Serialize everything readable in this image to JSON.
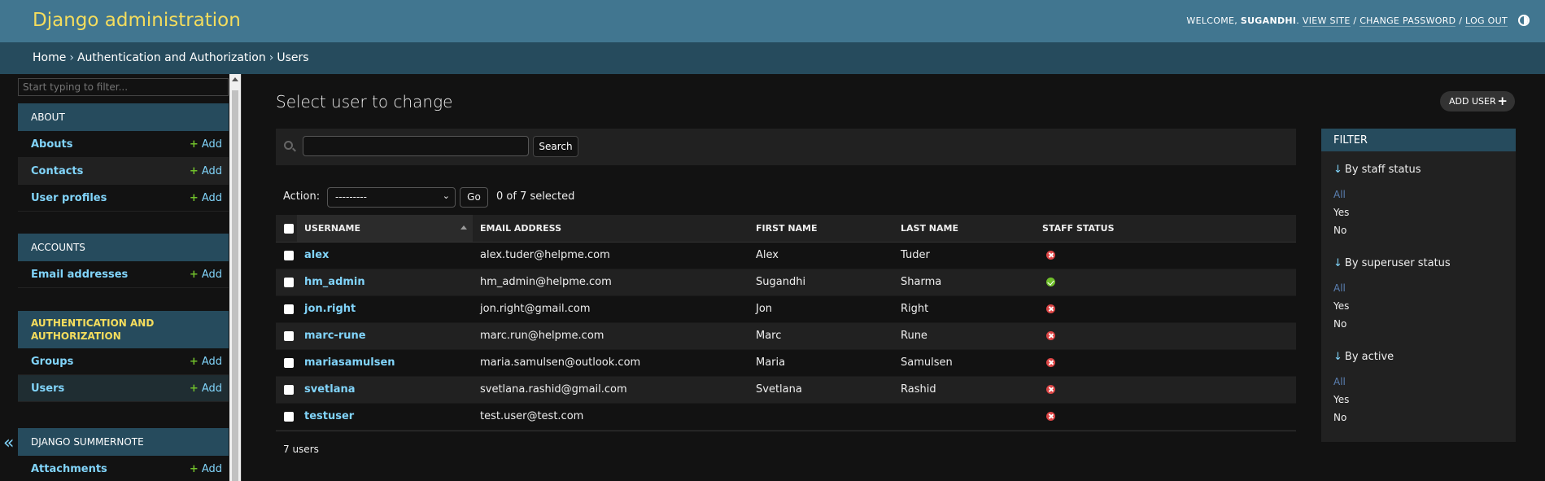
{
  "header": {
    "site_title": "Django administration",
    "welcome_text": "WELCOME,",
    "username": "SUGANDHI",
    "view_site": "VIEW SITE",
    "change_password": "CHANGE PASSWORD",
    "log_out": "LOG OUT",
    "sep": "/"
  },
  "breadcrumbs": {
    "home": "Home",
    "app": "Authentication and Authorization",
    "current": "Users",
    "sep": "›"
  },
  "sidebar": {
    "filter_placeholder": "Start typing to filter...",
    "add_label": "Add",
    "toggle_glyph": "«",
    "apps": [
      {
        "caption": "About",
        "models": [
          "Abouts",
          "Contacts",
          "User profiles"
        ]
      },
      {
        "caption": "Accounts",
        "models": [
          "Email addresses"
        ]
      },
      {
        "caption": "Authentication and Authorization",
        "models": [
          "Groups",
          "Users"
        ]
      },
      {
        "caption": "Django Summernote",
        "models": [
          "Attachments"
        ]
      }
    ]
  },
  "content": {
    "title": "Select user to change",
    "add_button": "ADD USER",
    "search_button": "Search",
    "action_label": "Action:",
    "action_value": "---------",
    "go_button": "Go",
    "selected_counter": "0 of 7 selected",
    "paginator": "7 users"
  },
  "table": {
    "columns": [
      "Username",
      "Email address",
      "First name",
      "Last name",
      "Staff status"
    ],
    "rows": [
      {
        "username": "alex",
        "email": "alex.tuder@helpme.com",
        "first": "Alex",
        "last": "Tuder",
        "staff": false
      },
      {
        "username": "hm_admin",
        "email": "hm_admin@helpme.com",
        "first": "Sugandhi",
        "last": "Sharma",
        "staff": true
      },
      {
        "username": "jon.right",
        "email": "jon.right@gmail.com",
        "first": "Jon",
        "last": "Right",
        "staff": false
      },
      {
        "username": "marc-rune",
        "email": "marc.run@helpme.com",
        "first": "Marc",
        "last": "Rune",
        "staff": false
      },
      {
        "username": "mariasamulsen",
        "email": "maria.samulsen@outlook.com",
        "first": "Maria",
        "last": "Samulsen",
        "staff": false
      },
      {
        "username": "svetlana",
        "email": "svetlana.rashid@gmail.com",
        "first": "Svetlana",
        "last": "Rashid",
        "staff": false
      },
      {
        "username": "testuser",
        "email": "test.user@test.com",
        "first": "",
        "last": "",
        "staff": false
      }
    ]
  },
  "filter": {
    "header": "Filter",
    "arrow": "↓",
    "sections": [
      {
        "title": "By staff status",
        "choices": [
          "All",
          "Yes",
          "No"
        ]
      },
      {
        "title": "By superuser status",
        "choices": [
          "All",
          "Yes",
          "No"
        ]
      },
      {
        "title": "By active",
        "choices": [
          "All",
          "Yes",
          "No"
        ]
      }
    ]
  },
  "colors": {
    "header_bg": "#417690",
    "breadcrumb_bg": "#264b5d",
    "brand": "#f5dd5d",
    "link": "#81d4fa",
    "add_green": "#70bf2b",
    "no_red": "#dd4646"
  }
}
